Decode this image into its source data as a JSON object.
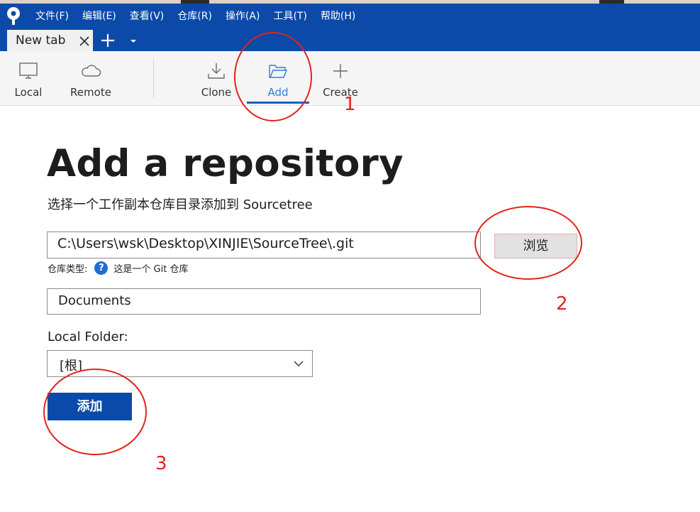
{
  "colors": {
    "brand": "#0b4aa8",
    "accent_active": "#2f7fd8",
    "annotation": "#e2231a"
  },
  "menu": [
    "文件(F)",
    "编辑(E)",
    "查看(V)",
    "仓库(R)",
    "操作(A)",
    "工具(T)",
    "帮助(H)"
  ],
  "tabs": [
    {
      "label": "New tab",
      "active": true
    }
  ],
  "toolbar": {
    "local": {
      "label": "Local",
      "icon": "monitor-icon"
    },
    "remote": {
      "label": "Remote",
      "icon": "cloud-icon"
    },
    "clone": {
      "label": "Clone",
      "icon": "download-icon"
    },
    "add": {
      "label": "Add",
      "icon": "folder-open-icon",
      "active": true
    },
    "create": {
      "label": "Create",
      "icon": "plus-icon"
    }
  },
  "content": {
    "title": "Add a repository",
    "subtitle": "选择一个工作副本仓库目录添加到 Sourcetree",
    "path_value": "C:\\Users\\wsk\\Desktop\\XINJIE\\SourceTree\\.git",
    "browse_label": "浏览",
    "repo_type_label": "仓库类型:",
    "repo_type_value": "这是一个 Git 仓库",
    "name_value": "Documents",
    "local_folder_label": "Local Folder:",
    "local_folder_value": "[根]",
    "add_button_label": "添加"
  },
  "annotations": [
    "1",
    "2",
    "3"
  ]
}
